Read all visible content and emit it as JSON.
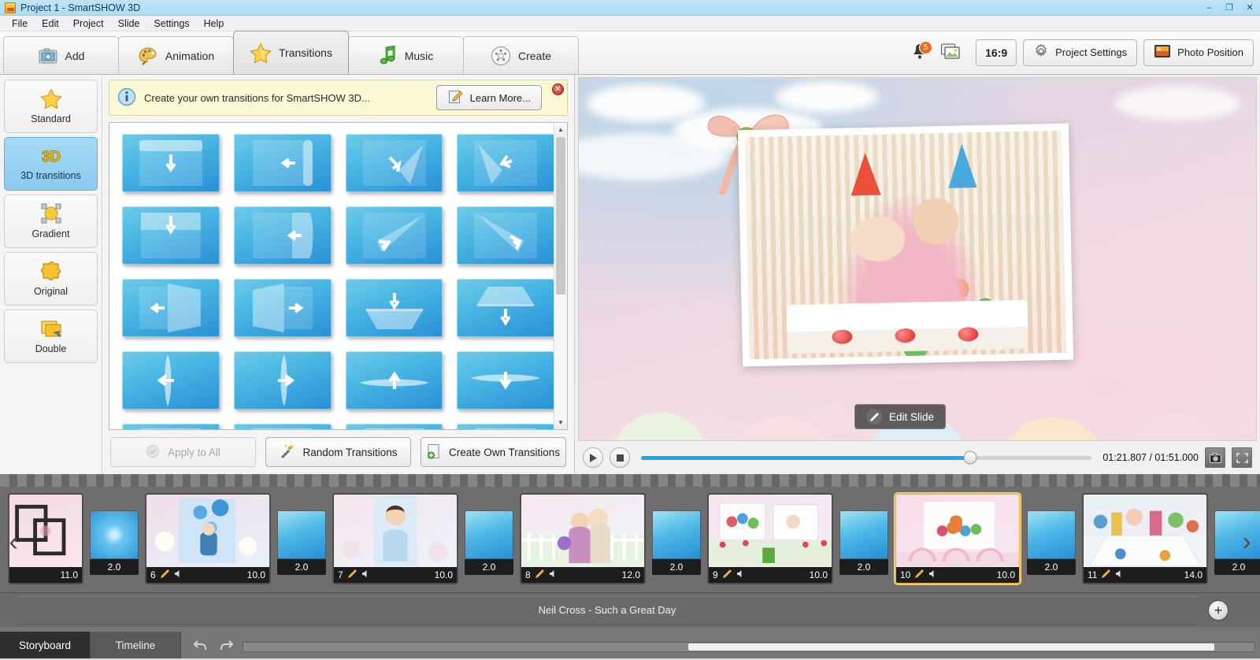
{
  "window": {
    "title": "Project 1 - SmartSHOW 3D",
    "icon": "app-icon",
    "controls": {
      "minimize": "–",
      "maximize": "❐",
      "close": "✕"
    }
  },
  "menu": {
    "items": [
      "File",
      "Edit",
      "Project",
      "Slide",
      "Settings",
      "Help"
    ]
  },
  "toolbar": {
    "tabs": [
      {
        "label": "Add",
        "icon": "add-photo-icon",
        "active": false
      },
      {
        "label": "Animation",
        "icon": "palette-icon",
        "active": false
      },
      {
        "label": "Transitions",
        "icon": "star-icon",
        "active": true
      },
      {
        "label": "Music",
        "icon": "music-note-icon",
        "active": false
      },
      {
        "label": "Create",
        "icon": "disc-icon",
        "active": false
      }
    ],
    "notifications_count": "5",
    "aspect_ratio": "16:9",
    "project_settings": "Project Settings",
    "photo_position": "Photo Position"
  },
  "sidebar": {
    "items": [
      {
        "label": "Standard",
        "icon": "star-icon",
        "active": false
      },
      {
        "label": "3D transitions",
        "icon": "3d-icon",
        "active": true
      },
      {
        "label": "Gradient",
        "icon": "gradient-icon",
        "active": false
      },
      {
        "label": "Original",
        "icon": "puzzle-icon",
        "active": false
      },
      {
        "label": "Double",
        "icon": "double-icon",
        "active": false
      }
    ]
  },
  "notice": {
    "text": "Create your own transitions for SmartSHOW 3D...",
    "button": "Learn More...",
    "close": "✕"
  },
  "transitions": {
    "tiles": [
      {
        "name": "roll-down"
      },
      {
        "name": "roll-left"
      },
      {
        "name": "peel-corner-down"
      },
      {
        "name": "peel-corner-left"
      },
      {
        "name": "fold-down"
      },
      {
        "name": "fold-left"
      },
      {
        "name": "peel-diagonal-up"
      },
      {
        "name": "peel-diagonal-down"
      },
      {
        "name": "door-left"
      },
      {
        "name": "door-right"
      },
      {
        "name": "tilt-in-down"
      },
      {
        "name": "tilt-out-down"
      },
      {
        "name": "flip-left"
      },
      {
        "name": "flip-right"
      },
      {
        "name": "flip-up"
      },
      {
        "name": "flip-down"
      },
      {
        "name": "partial-row-a"
      },
      {
        "name": "partial-row-b"
      },
      {
        "name": "partial-row-c"
      },
      {
        "name": "partial-row-d"
      }
    ]
  },
  "panel_actions": {
    "apply_to_all": "Apply to All",
    "random_transitions": "Random Transitions",
    "create_own_transitions": "Create Own Transitions"
  },
  "preview": {
    "edit_slide": "Edit Slide",
    "current_time": "01:21.807",
    "total_time": "01:51.000",
    "timecode": "01:21.807 / 01:51.000",
    "progress_percent": 73,
    "play": "▶",
    "stop": "■",
    "snapshot_icon": "camera-icon",
    "fullscreen_icon": "fullscreen-icon"
  },
  "storyboard": {
    "transition_duration": "2.0",
    "slides": [
      {
        "number": "",
        "duration": "11.0",
        "selected": false,
        "partial": true,
        "thumb": "pink-frames"
      },
      {
        "number": "6",
        "duration": "10.0",
        "selected": false,
        "thumb": "blue-balloons"
      },
      {
        "number": "7",
        "duration": "10.0",
        "selected": false,
        "thumb": "boy-portrait"
      },
      {
        "number": "8",
        "duration": "12.0",
        "selected": false,
        "thumb": "garden-family"
      },
      {
        "number": "9",
        "duration": "10.0",
        "selected": false,
        "thumb": "collage-tulips"
      },
      {
        "number": "10",
        "duration": "10.0",
        "selected": true,
        "thumb": "party-group"
      },
      {
        "number": "11",
        "duration": "14.0",
        "selected": false,
        "thumb": "toy-room"
      }
    ],
    "scroll_left": "‹",
    "scroll_right": "›"
  },
  "music": {
    "track": "Neil Cross - Such a Great Day",
    "add_button": "+"
  },
  "view_tabs": [
    {
      "label": "Storyboard",
      "active": true
    },
    {
      "label": "Timeline",
      "active": false
    }
  ],
  "status": {
    "undo_icon": "undo-icon",
    "redo_icon": "redo-icon"
  },
  "colors": {
    "accent_blue": "#19a8ec",
    "selected_slide": "#f0b84a",
    "sidebar_active": "#8ccaf0",
    "notice_bg": "#fbf8d5",
    "badge": "#f06a1e"
  }
}
